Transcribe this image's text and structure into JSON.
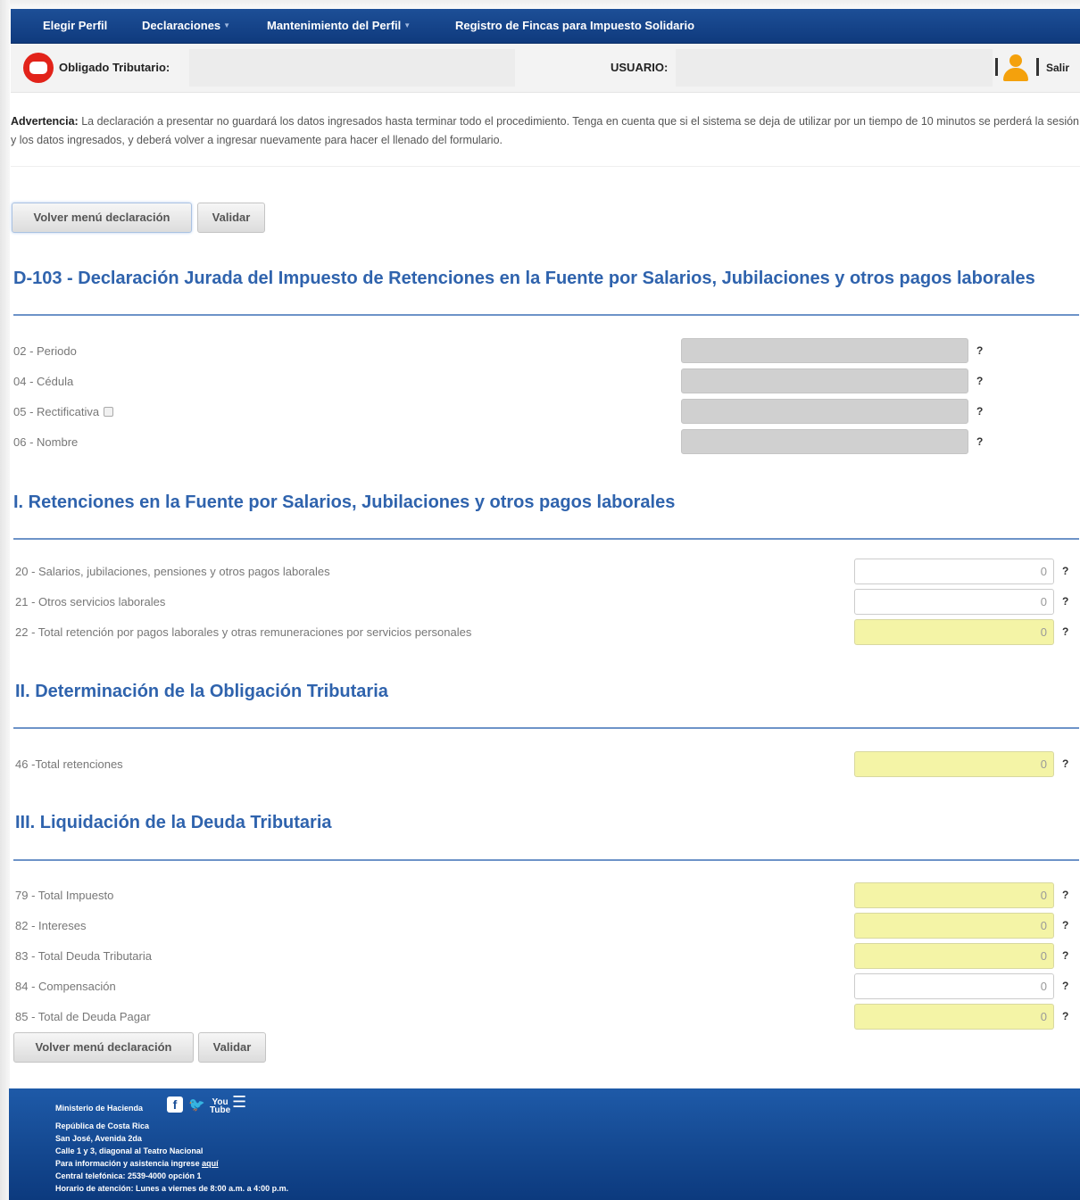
{
  "nav": {
    "items": [
      {
        "label": "Elegir Perfil",
        "dropdown": false
      },
      {
        "label": "Declaraciones",
        "dropdown": true
      },
      {
        "label": "Mantenimiento del Perfil",
        "dropdown": true
      },
      {
        "label": "Registro de Fincas para Impuesto Solidario",
        "dropdown": false
      }
    ]
  },
  "header": {
    "taxpayer_label": "Obligado Tributario:",
    "taxpayer_value": "",
    "user_label": "USUARIO:",
    "user_value": "",
    "logout_label": "Salir"
  },
  "warning": {
    "title": "Advertencia:",
    "text": " La declaración a presentar no guardará los datos ingresados hasta terminar todo el procedimiento. Tenga en cuenta que si el sistema se deja de utilizar por un tiempo de 10 minutos se perderá la sesión y los datos ingresados, y deberá volver a ingresar nuevamente para hacer el llenado del formulario."
  },
  "actions": {
    "back_label": "Volver menú declaración",
    "validate_label": "Validar"
  },
  "form_title": "D-103 - Declaración Jurada del Impuesto de Retenciones en la Fuente por Salarios, Jubilaciones y otros pagos laborales",
  "help_symbol": "?",
  "identification": {
    "fields": [
      {
        "label": "02 - Periodo",
        "value": ""
      },
      {
        "label": "04 - Cédula",
        "value": ""
      },
      {
        "label": "05 - Rectificativa",
        "value": "",
        "checkbox": true
      },
      {
        "label": "06 - Nombre",
        "value": ""
      }
    ]
  },
  "sections": [
    {
      "title": "I. Retenciones en la Fuente por Salarios, Jubilaciones y otros pagos laborales",
      "fields": [
        {
          "label": "20 - Salarios, jubilaciones, pensiones y otros pagos laborales",
          "value": "0",
          "readonly": false
        },
        {
          "label": "21 - Otros servicios laborales",
          "value": "0",
          "readonly": false
        },
        {
          "label": "22 - Total retención por pagos laborales y otras remuneraciones por servicios personales",
          "value": "0",
          "readonly": true
        }
      ]
    },
    {
      "title": "II. Determinación de la Obligación Tributaria",
      "fields": [
        {
          "label": "46 -Total retenciones",
          "value": "0",
          "readonly": true
        }
      ]
    },
    {
      "title": "III. Liquidación de la Deuda Tributaria",
      "fields": [
        {
          "label": "79 - Total Impuesto",
          "value": "0",
          "readonly": true
        },
        {
          "label": "82 - Intereses",
          "value": "0",
          "readonly": true
        },
        {
          "label": "83 - Total Deuda Tributaria",
          "value": "0",
          "readonly": true
        },
        {
          "label": "84 - Compensación",
          "value": "0",
          "readonly": false
        },
        {
          "label": "85 - Total de Deuda Pagar",
          "value": "0",
          "readonly": true
        }
      ]
    }
  ],
  "colors": {
    "nav_bg": "#15458c",
    "title_blue": "#2f63ad",
    "readonly_field": "#f4f4a6",
    "footer_bg": "#1a4f98",
    "logo_red": "#e2231a",
    "user_icon": "#f4a10c"
  },
  "footer": {
    "ministry": "Ministerio de Hacienda",
    "social_icons": [
      "facebook-icon",
      "twitter-icon",
      "youtube-icon",
      "list-icon"
    ],
    "line1": "República de Costa Rica",
    "line2": "San José, Avenida 2da",
    "line3": "Calle 1 y 3, diagonal al Teatro Nacional",
    "line4_prefix": "Para información y asistencia ingrese ",
    "line4_link": "aquí",
    "line5": "Central telefónica: 2539-4000 opción 1",
    "line6": "Horario de atención: Lunes a viernes de 8:00 a.m. a 4:00 p.m."
  }
}
